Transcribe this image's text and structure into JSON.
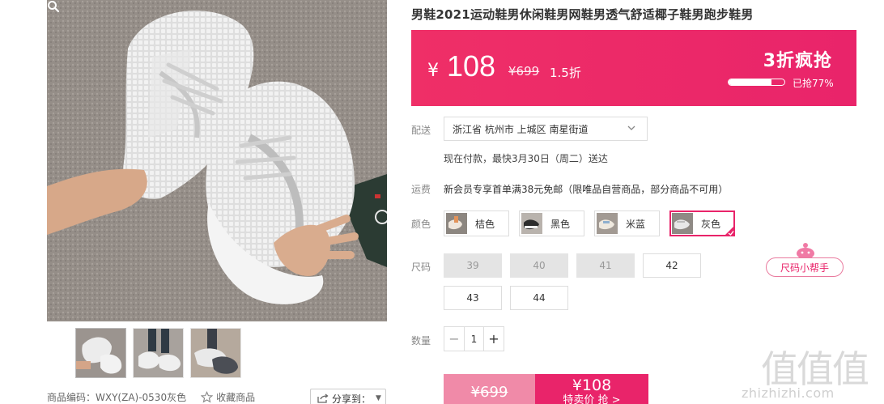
{
  "product": {
    "title": "男鞋2021运动鞋男休闲鞋男网鞋男透气舒适椰子鞋男跑步鞋男",
    "code": "商品编码：WXY(ZA)-0530灰色",
    "favorite_label": "收藏商品",
    "share_label": "分享到："
  },
  "gallery": {
    "zoom_icon": "magnifier-icon",
    "thumbnails": 3
  },
  "price": {
    "currency": "¥",
    "current": "108",
    "original": "¥699",
    "discount": "1.5折",
    "flash_label": "3折疯抢",
    "sold_text": "已抢77%",
    "sold_fraction": 0.77
  },
  "delivery": {
    "label": "配送",
    "address": "浙江省 杭州市 上城区 南星街道",
    "eta": "现在付款，最快3月30日（周二）送达"
  },
  "shipping": {
    "label": "运费",
    "text": "新会员专享首单满38元免邮（限唯品自营商品，部分商品不可用）"
  },
  "colors": {
    "label": "颜色",
    "options": [
      {
        "name": "桔色",
        "selected": false
      },
      {
        "name": "黑色",
        "selected": false
      },
      {
        "name": "米蓝",
        "selected": false
      },
      {
        "name": "灰色",
        "selected": true
      }
    ]
  },
  "sizes": {
    "label": "尺码",
    "options": [
      {
        "value": "39",
        "available": false
      },
      {
        "value": "40",
        "available": false
      },
      {
        "value": "41",
        "available": false
      },
      {
        "value": "42",
        "available": true
      },
      {
        "value": "43",
        "available": true
      },
      {
        "value": "44",
        "available": true
      }
    ],
    "helper_label": "尺码小帮手"
  },
  "quantity": {
    "label": "数量",
    "minus": "−",
    "value": "1",
    "plus": "+"
  },
  "buy": {
    "original_price": "¥699",
    "price": "¥108",
    "action": "特卖价 抢 >"
  },
  "watermark": {
    "glyphs": "值值值",
    "url": "zhizhizhi.com"
  },
  "colors_theme": {
    "accent": "#e9246a",
    "accent_light": "#f08aa8"
  }
}
